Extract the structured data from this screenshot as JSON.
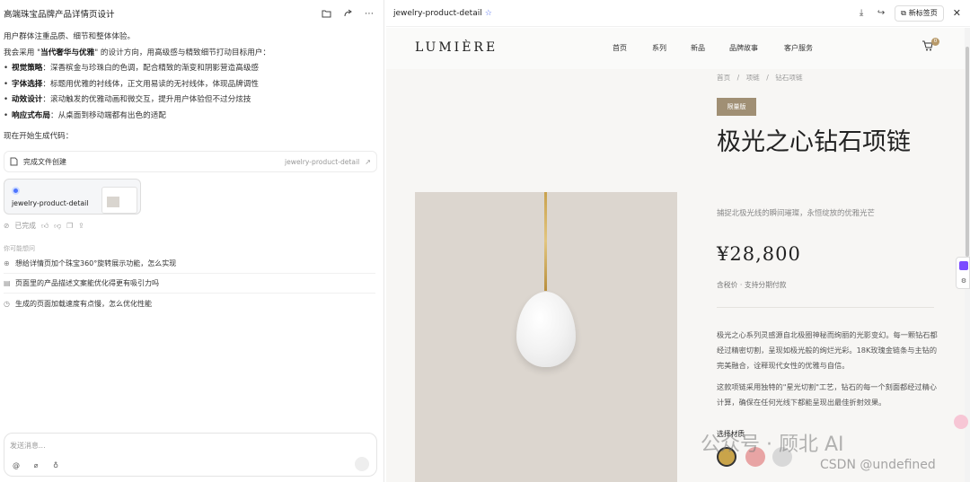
{
  "left": {
    "title": "高端珠宝品牌产品详情页设计",
    "header_icons": [
      "folder-icon",
      "share-icon",
      "more-icon"
    ],
    "chat": {
      "p1": "用户群体注重品质、细节和整体体验。",
      "p2_pre": "我会采用 \"",
      "p2_bold": "当代奢华与优雅",
      "p2_post": "\" 的设计方向，用高级感与精致细节打动目标用户：",
      "bullets": [
        {
          "k": "视觉策略",
          "v": "：深香槟金与珍珠白的色调，配合精致的渐变和阴影营造高级感"
        },
        {
          "k": "字体选择",
          "v": "：标题用优雅的衬线体，正文用易读的无衬线体，体现品牌调性"
        },
        {
          "k": "动效设计",
          "v": "：滚动触发的优雅动画和微交互，提升用户体验但不过分炫技"
        },
        {
          "k": "响应式布局",
          "v": "：从桌面到移动端都有出色的适配"
        }
      ],
      "p3": "现在开始生成代码："
    },
    "file_card": {
      "label": "完成文件创建",
      "path": "jewelry-product-detail"
    },
    "preview_card": {
      "name": "jewelry-product-detail"
    },
    "actions": {
      "done": "已完成"
    },
    "suggest_label": "你可能想问",
    "suggestions": [
      "想给详情页加个珠宝360°旋转展示功能，怎么实现",
      "页面里的产品描述文案能优化得更有吸引力吗",
      "生成的页面加载速度有点慢，怎么优化性能"
    ],
    "input": {
      "placeholder": "发送消息..."
    }
  },
  "right": {
    "tab_title": "jewelry-product-detail",
    "new_tab": "新标签页",
    "site": {
      "logo": "LUMIÈRE",
      "nav": [
        "首页",
        "系列",
        "新品",
        "品牌故事",
        "客户服务"
      ],
      "cart_count": "0",
      "breadcrumb": [
        "首页",
        "/",
        "项链",
        "/",
        "钻石项链"
      ],
      "badge": "限量版",
      "title": "极光之心钻石项链",
      "subtitle": "捕捉北极光线的瞬间璀璨，永恒绽放的优雅光芒",
      "price": "¥28,800",
      "tax_note": "含税价 · 支持分期付款",
      "desc1": "极光之心系列灵感源自北极圈神秘而绚丽的光影变幻。每一颗钻石都经过精密切割，呈现如极光般的绚烂光彩。18K玫瑰金链条与主钻的完美融合，诠释现代女性的优雅与自信。",
      "desc2": "这款项链采用独特的\"星光切割\"工艺，钻石的每一个刻面都经过精心计算，确保在任何光线下都能呈现出最佳折射效果。",
      "material_label": "选择材质",
      "swatch_colors": [
        "#c9a44a",
        "#e8a4a4",
        "#d8d8d8"
      ]
    }
  },
  "watermark": {
    "line1": "公众号 · 顾北 AI",
    "line2": "CSDN @undefined"
  }
}
